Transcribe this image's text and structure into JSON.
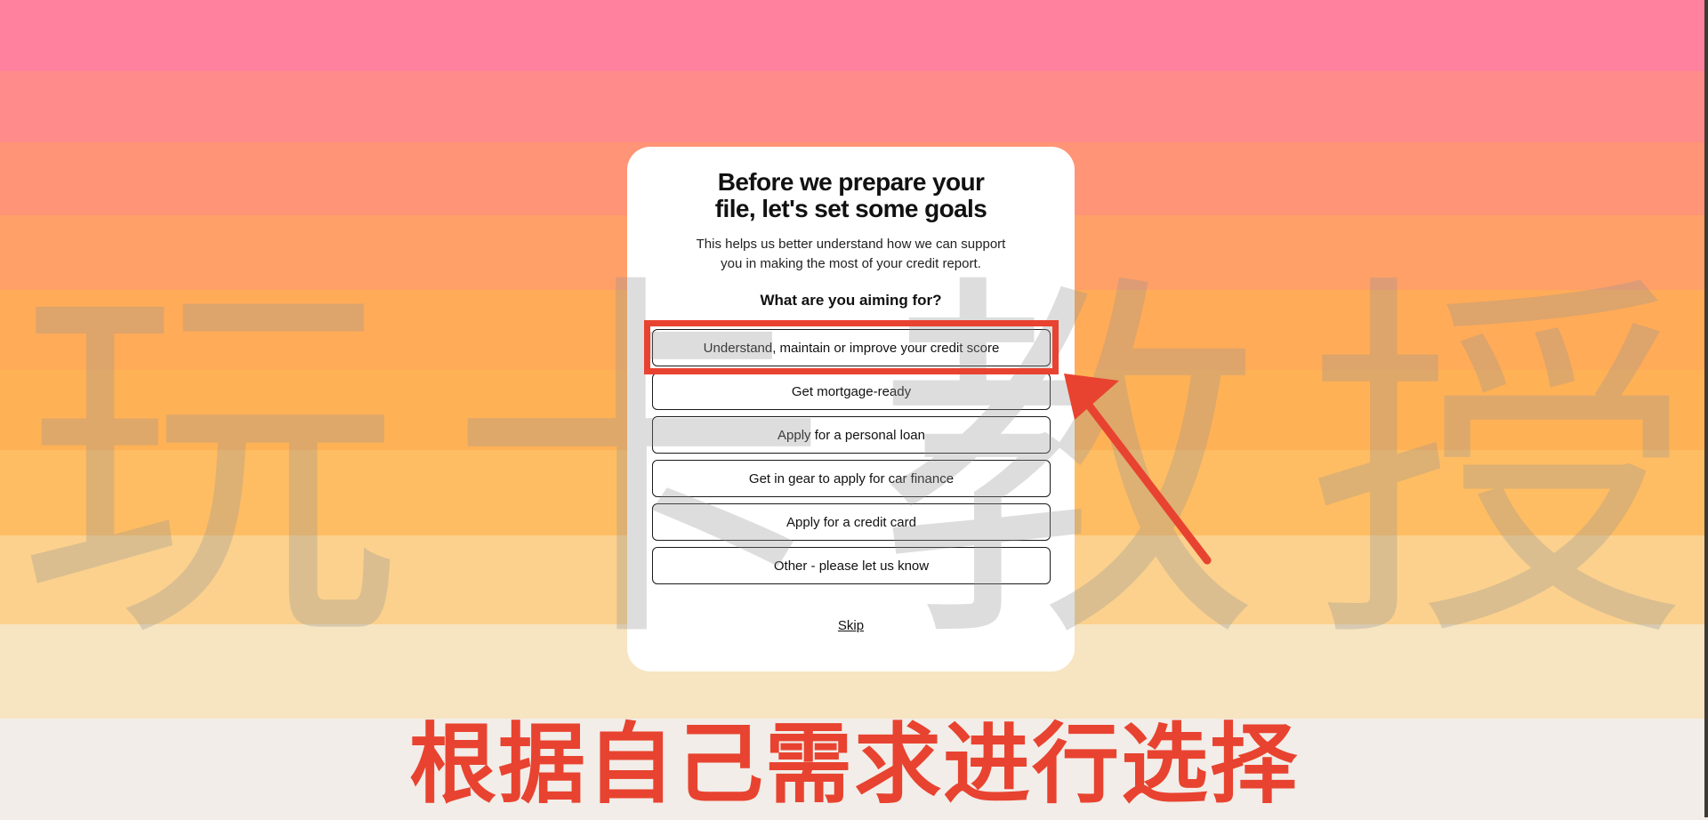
{
  "card": {
    "title_line1": "Before we prepare your",
    "title_line2": "file, let's set some goals",
    "subtitle_line1": "This helps us better understand how we can support",
    "subtitle_line2": "you in making the most of your credit report.",
    "question": "What are you aiming for?",
    "options": [
      "Understand, maintain or improve your credit score",
      "Get mortgage-ready",
      "Apply for a personal loan",
      "Get in gear to apply for car finance",
      "Apply for a credit card",
      "Other - please let us know"
    ],
    "skip_label": "Skip"
  },
  "overlay": {
    "watermark_chars": [
      "玩",
      "卡",
      "教",
      "授"
    ],
    "caption": "根据自己需求进行选择",
    "accent_color": "#e84330"
  }
}
